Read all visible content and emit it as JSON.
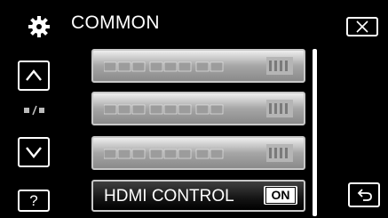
{
  "header": {
    "title": "COMMON",
    "icon": "gear-icon"
  },
  "sidebar": {
    "up_icon": "chevron-up-icon",
    "down_icon": "chevron-down-icon",
    "help_label": "?"
  },
  "menu": {
    "items": [
      {
        "label": "HDMI CONTROL",
        "state": "ON"
      }
    ]
  },
  "controls": {
    "close_icon": "close-icon",
    "back_icon": "return-icon"
  },
  "colors": {
    "background": "#000000",
    "item_fill_top": "#eeeeee",
    "item_fill_bottom": "#8a8a8a",
    "accent": "#ffffff"
  }
}
